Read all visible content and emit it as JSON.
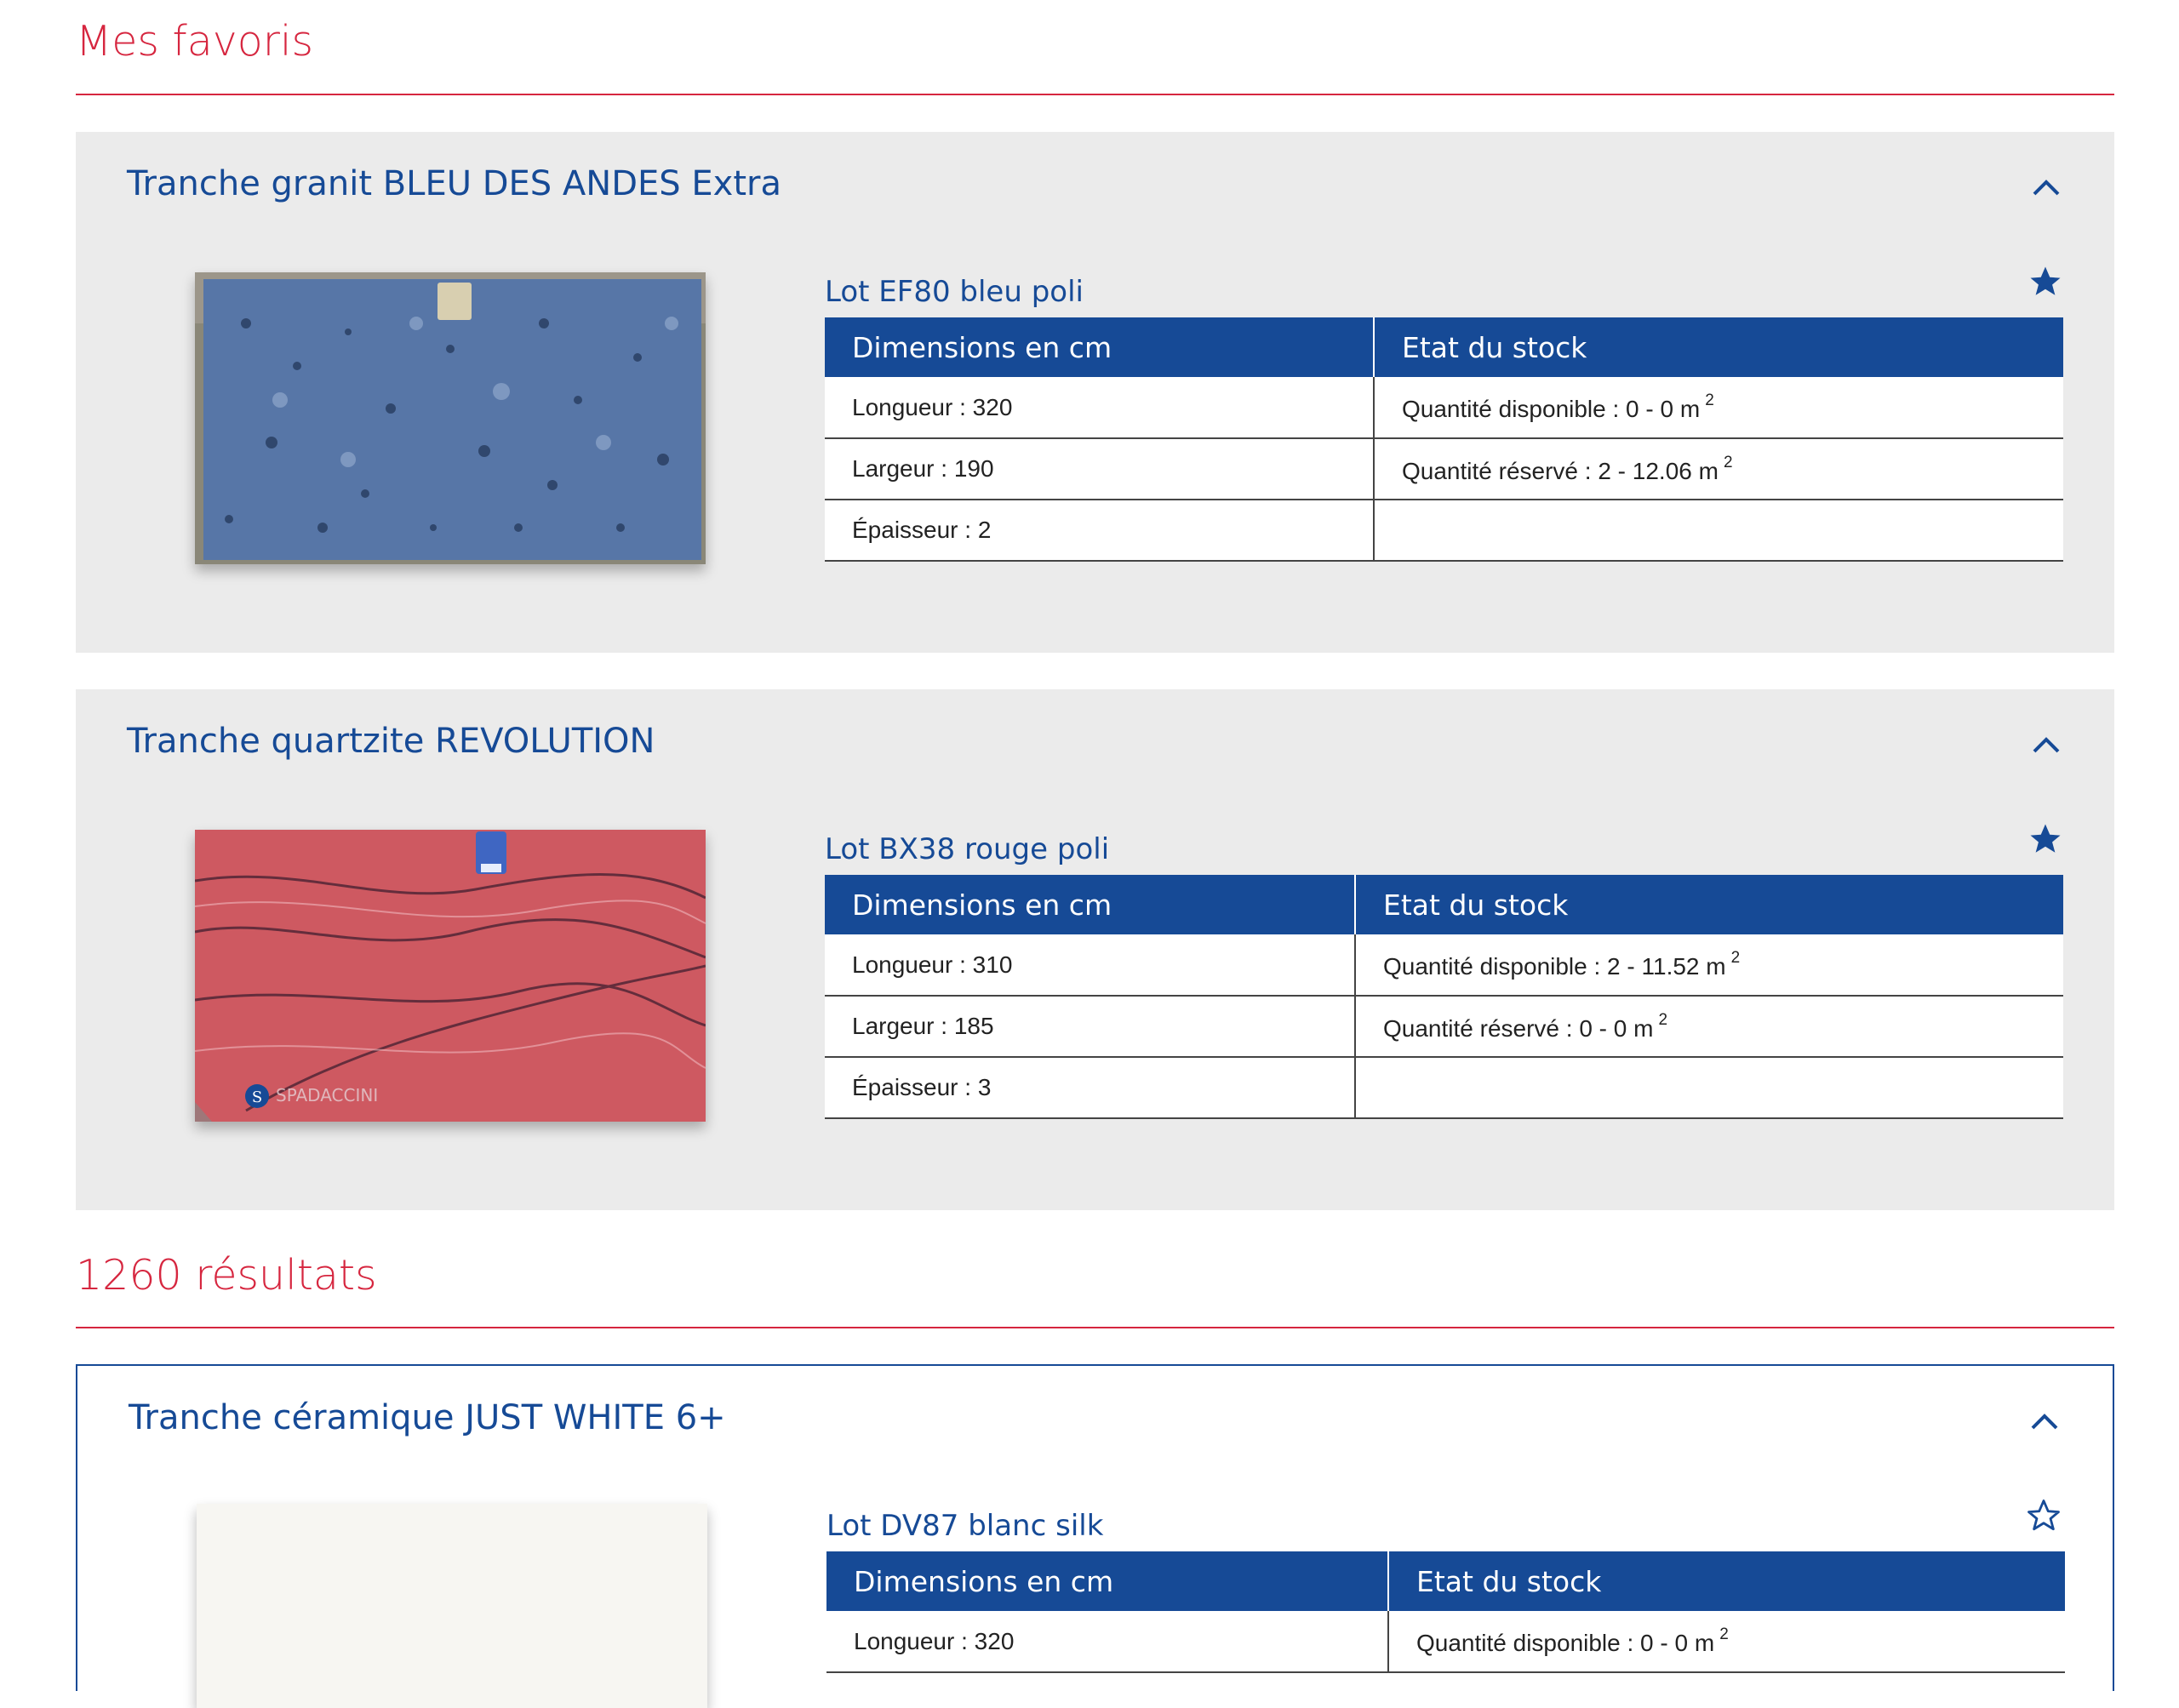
{
  "favorites_section": {
    "title": "Mes favoris"
  },
  "results_section": {
    "title": "1260 résultats"
  },
  "table_headers": {
    "dimensions": "Dimensions en cm",
    "stock": "Etat du stock"
  },
  "unit_superscript": "2",
  "colors": {
    "accent_red": "#d6263f",
    "brand_blue": "#164a96",
    "card_gray": "#ebebeb"
  },
  "icons": {
    "collapse": "chevron-up-icon",
    "favorite_on": "star-filled-icon",
    "favorite_off": "star-outline-icon"
  },
  "favorites": [
    {
      "title": "Tranche granit BLEU DES ANDES Extra",
      "lot": "Lot EF80 bleu poli",
      "favorited": true,
      "rows": [
        {
          "dim": "Longueur : 320",
          "stock": "Quantité disponible : 0 - 0 m"
        },
        {
          "dim": "Largeur : 190",
          "stock": "Quantité réservé : 2 - 12.06 m"
        },
        {
          "dim": "Épaisseur : 2",
          "stock": ""
        }
      ]
    },
    {
      "title": "Tranche quartzite REVOLUTION",
      "lot": "Lot BX38 rouge poli",
      "favorited": true,
      "logo_text": "SPADACCINI",
      "rows": [
        {
          "dim": "Longueur : 310",
          "stock": "Quantité disponible : 2 - 11.52 m"
        },
        {
          "dim": "Largeur : 185",
          "stock": "Quantité réservé : 0 - 0 m"
        },
        {
          "dim": "Épaisseur : 3",
          "stock": ""
        }
      ]
    }
  ],
  "results": [
    {
      "title": "Tranche céramique JUST WHITE 6+",
      "lot": "Lot DV87 blanc silk",
      "favorited": false,
      "rows": [
        {
          "dim": "Longueur : 320",
          "stock": "Quantité disponible : 0 - 0 m"
        }
      ]
    }
  ]
}
